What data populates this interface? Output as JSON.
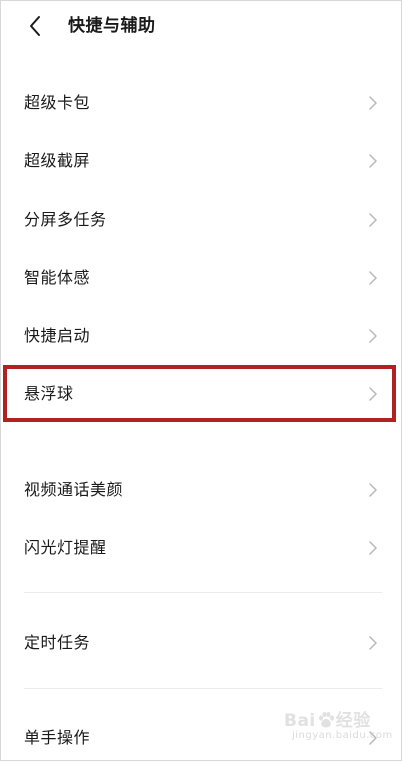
{
  "header": {
    "title": "快捷与辅助",
    "back_icon": "chevron-left-icon"
  },
  "items": [
    {
      "label": "超级卡包"
    },
    {
      "label": "超级截屏"
    },
    {
      "label": "分屏多任务"
    },
    {
      "label": "智能体感"
    },
    {
      "label": "快捷启动"
    },
    {
      "label": "悬浮球",
      "highlighted": true
    },
    {
      "label": "视频通话美颜"
    },
    {
      "label": "闪光灯提醒"
    },
    {
      "label": "定时任务"
    },
    {
      "label": "单手操作"
    }
  ],
  "chevron_icon": "chevron-right-icon",
  "highlight_color": "#b02222",
  "watermark": {
    "logo_left": "Bai",
    "logo_right": "经验",
    "sub": "jingyan.baidu.com"
  }
}
